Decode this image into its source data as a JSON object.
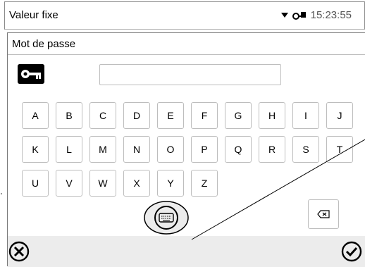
{
  "statusbar": {
    "title": "Valeur fixe",
    "time": "15:23:55",
    "dropdown_icon": "triangle-down-icon",
    "lock_icon": "key-lock-icon"
  },
  "dialog": {
    "title": "Mot de passe",
    "password_value": "",
    "key_icon": "key-icon"
  },
  "keyboard": {
    "row1": [
      "A",
      "B",
      "C",
      "D",
      "E",
      "F",
      "G",
      "H",
      "I",
      "J"
    ],
    "row2": [
      "K",
      "L",
      "M",
      "N",
      "O",
      "P",
      "Q",
      "R",
      "S",
      "T"
    ],
    "row3": [
      "U",
      "V",
      "W",
      "X",
      "Y",
      "Z"
    ],
    "backspace_icon": "backspace-icon"
  },
  "bottombar": {
    "cancel_icon": "cancel-icon",
    "keyboard_icon": "keyboard-icon",
    "confirm_icon": "checkmark-icon"
  },
  "colors": {
    "border": "#bdbdbd",
    "bottombar_bg": "#ececec"
  }
}
